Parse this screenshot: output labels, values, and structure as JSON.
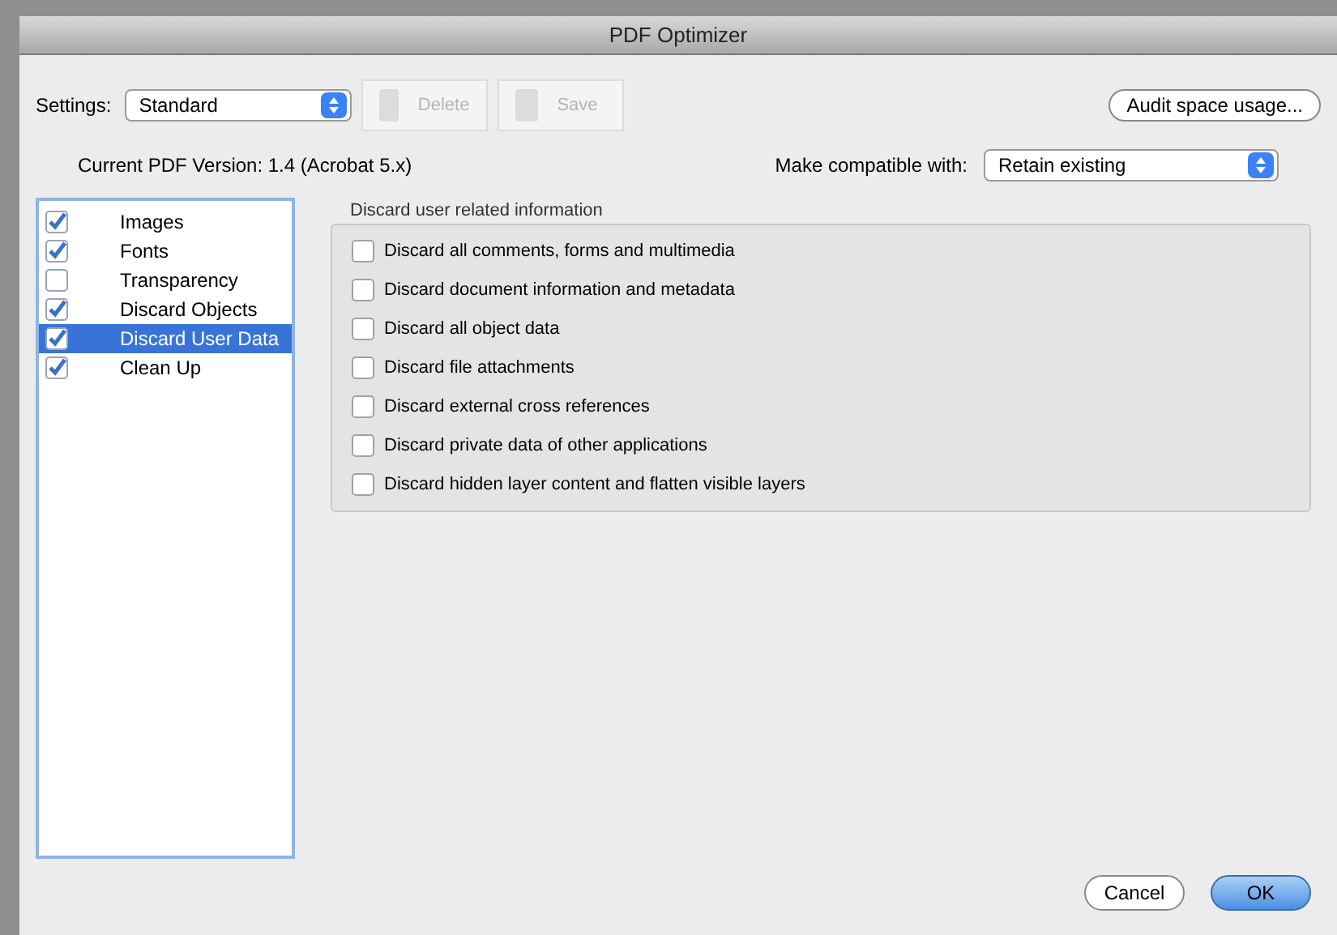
{
  "window": {
    "title": "PDF Optimizer"
  },
  "settings": {
    "label": "Settings:",
    "value": "Standard"
  },
  "toolbar_buttons": [
    {
      "label": "Delete",
      "disabled": true
    },
    {
      "label": "Save",
      "disabled": true
    }
  ],
  "audit_button": "Audit space usage...",
  "version": "Current PDF Version: 1.4 (Acrobat 5.x)",
  "compatible": {
    "label": "Make compatible with:",
    "value": "Retain existing"
  },
  "sidebar": {
    "items": [
      {
        "label": "Images",
        "checked": true,
        "selected": false
      },
      {
        "label": "Fonts",
        "checked": true,
        "selected": false
      },
      {
        "label": "Transparency",
        "checked": false,
        "selected": false
      },
      {
        "label": "Discard Objects",
        "checked": true,
        "selected": false
      },
      {
        "label": "Discard User Data",
        "checked": true,
        "selected": true
      },
      {
        "label": "Clean Up",
        "checked": true,
        "selected": false
      }
    ]
  },
  "panel": {
    "title": "Discard user related information",
    "options": [
      {
        "label": "Discard all comments, forms and multimedia",
        "checked": false
      },
      {
        "label": "Discard document information and metadata",
        "checked": false
      },
      {
        "label": "Discard all object data",
        "checked": false
      },
      {
        "label": "Discard file attachments",
        "checked": false
      },
      {
        "label": "Discard external cross references",
        "checked": false
      },
      {
        "label": "Discard private data of other applications",
        "checked": false
      },
      {
        "label": "Discard hidden layer content and flatten visible layers",
        "checked": false
      }
    ]
  },
  "buttons": [
    {
      "label": "Cancel",
      "default": false
    },
    {
      "label": "OK",
      "default": true
    }
  ]
}
